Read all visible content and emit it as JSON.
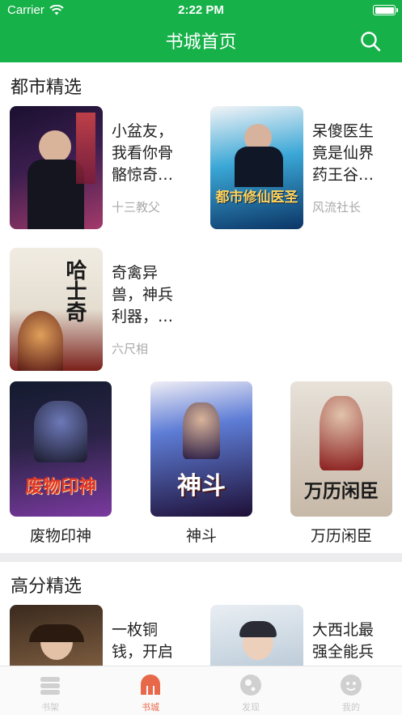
{
  "status": {
    "carrier": "Carrier",
    "time": "2:22 PM"
  },
  "nav": {
    "title": "书城首页"
  },
  "sections": [
    {
      "title": "都市精选",
      "books": [
        {
          "title": "小盆友，我看你骨骼惊奇…",
          "author": "十三教父",
          "cover_text": "",
          "cover_colors": [
            "#1a1030",
            "#a33a6b"
          ]
        },
        {
          "title": "呆傻医生竟是仙界药王谷…",
          "author": "风流社长",
          "cover_text": "都市修仙医圣",
          "cover_colors": [
            "#0b3566",
            "#3aa7d6"
          ]
        },
        {
          "title": "奇禽异兽，神兵利器，…",
          "author": "六尺相",
          "cover_text": "哈士奇",
          "cover_colors": [
            "#f1ece3",
            "#7a1f1a"
          ]
        }
      ],
      "featured": [
        {
          "title": "废物印神",
          "cover_text": "废物印神",
          "cover_colors": [
            "#131b2e",
            "#7b3aa0"
          ]
        },
        {
          "title": "神斗",
          "cover_text": "神斗",
          "cover_colors": [
            "#1e0f36",
            "#5e7dd6"
          ]
        },
        {
          "title": "万历闲臣",
          "cover_text": "万历闲臣",
          "cover_colors": [
            "#e8e2da",
            "#8a1d1d"
          ]
        }
      ]
    },
    {
      "title": "高分精选",
      "books": [
        {
          "title": "一枚铜钱，开启宿意男…",
          "author": "",
          "cover_text": "",
          "cover_colors": [
            "#3a2a1e",
            "#b48a5a"
          ]
        },
        {
          "title": "大西北最强全能兵王，本…",
          "author": "",
          "cover_text": "",
          "cover_colors": [
            "#9fb4c6",
            "#e9eef3"
          ]
        }
      ]
    }
  ],
  "tabs": [
    {
      "label": "书架",
      "icon": "bookshelf-icon",
      "active": false
    },
    {
      "label": "书城",
      "icon": "bookstore-icon",
      "active": true
    },
    {
      "label": "发现",
      "icon": "discover-icon",
      "active": false
    },
    {
      "label": "我的",
      "icon": "profile-icon",
      "active": false
    }
  ],
  "colors": {
    "brand": "#17b14a",
    "tab_active": "#e8684a",
    "tab_inactive": "#c9c9c9"
  }
}
